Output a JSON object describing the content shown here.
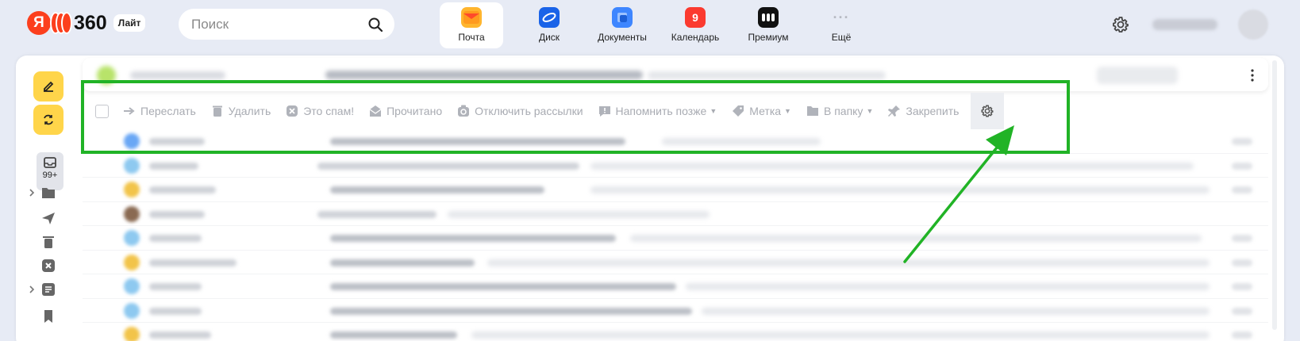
{
  "header": {
    "logo_letter": "Я",
    "logo_brand": "360",
    "logo_badge": "Лайт",
    "search_placeholder": "Поиск",
    "apps": [
      {
        "label": "Почта",
        "icon": "mail-envelope-icon",
        "color": "#ffb52e"
      },
      {
        "label": "Диск",
        "icon": "cloud-disk-icon",
        "color": "#1a63e8"
      },
      {
        "label": "Документы",
        "icon": "documents-icon",
        "color": "#3e86ff"
      },
      {
        "label": "Календарь",
        "icon": "calendar-icon",
        "color": "#fb3a2f",
        "badge": "9"
      },
      {
        "label": "Премиум",
        "icon": "premium-icon",
        "color": "#111111"
      },
      {
        "label": "Ещё",
        "icon": "more-dots-icon",
        "color": "#b7bac2"
      }
    ]
  },
  "sidebar": {
    "inbox_count": "99+"
  },
  "toolbar": {
    "forward": "Переслать",
    "delete": "Удалить",
    "spam": "Это спам!",
    "read": "Прочитано",
    "unsubscribe": "Отключить рассылки",
    "remind": "Напомнить позже",
    "label": "Метка",
    "folder": "В папку",
    "pin": "Закрепить"
  },
  "colors": {
    "accent_yellow": "#ffd54a",
    "highlight_green": "#21b326",
    "disabled_text": "#a8abb2"
  }
}
